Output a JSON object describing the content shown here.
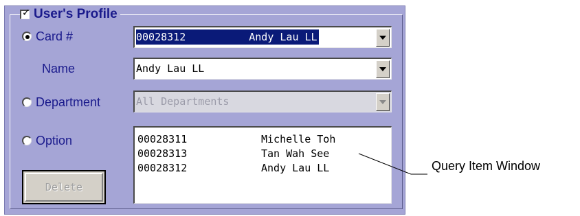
{
  "group": {
    "title": "User's Profile",
    "checked": true
  },
  "rows": {
    "card": {
      "label": "Card #",
      "radio_selected": true,
      "id": "00028312",
      "name": "Andy Lau LL"
    },
    "name": {
      "label": "Name",
      "value": "Andy Lau LL"
    },
    "department": {
      "label": "Department",
      "radio_selected": false,
      "value": "All Departments"
    },
    "option": {
      "label": "Option",
      "radio_selected": false
    }
  },
  "query_list": {
    "items": [
      {
        "id": "00028311",
        "name": "Michelle Toh"
      },
      {
        "id": "00028313",
        "name": "Tan Wah See"
      },
      {
        "id": "00028312",
        "name": "Andy Lau LL"
      }
    ]
  },
  "delete_button": {
    "label": "Delete"
  },
  "callout": {
    "label": "Query Item Window"
  },
  "icons": {
    "checkbox": "check-icon",
    "dropdown": "chevron-down-icon"
  },
  "colors": {
    "panel": "#a5a5d6",
    "label_text": "#1a1a8c",
    "selection": "#0a1a78"
  }
}
